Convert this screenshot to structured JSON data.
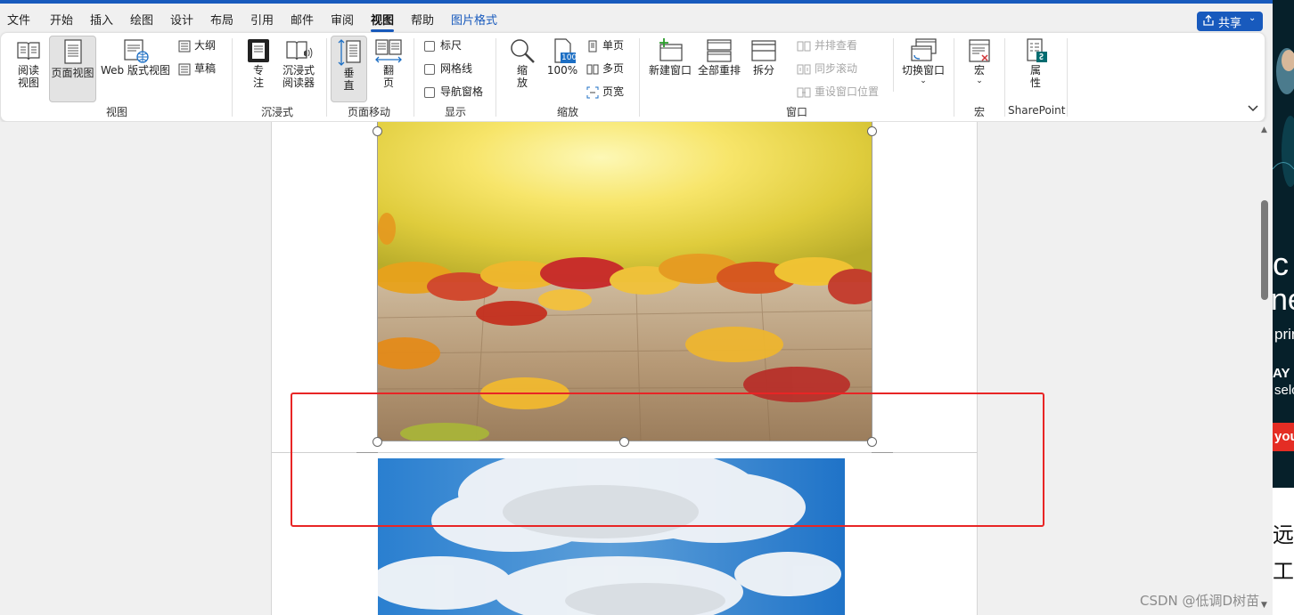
{
  "menubar": {
    "tabs": [
      {
        "label": "文件"
      },
      {
        "label": "开始"
      },
      {
        "label": "插入"
      },
      {
        "label": "绘图"
      },
      {
        "label": "设计"
      },
      {
        "label": "布局"
      },
      {
        "label": "引用"
      },
      {
        "label": "邮件"
      },
      {
        "label": "审阅"
      },
      {
        "label": "视图"
      },
      {
        "label": "帮助"
      },
      {
        "label": "图片格式"
      }
    ],
    "active_tab": "视图",
    "share_label": "共享"
  },
  "ribbon": {
    "view_group": {
      "label": "视图",
      "read_mode_1": "阅读",
      "read_mode_2": "视图",
      "print_layout": "页面视图",
      "web_layout": "Web 版式视图",
      "outline": "大纲",
      "draft": "草稿"
    },
    "immersive_group": {
      "label": "沉浸式",
      "focus_1": "专",
      "focus_2": "注",
      "reader_1": "沉浸式",
      "reader_2": "阅读器"
    },
    "page_movement_group": {
      "label": "页面移动",
      "vertical_1": "垂",
      "vertical_2": "直",
      "side_1": "翻",
      "side_2": "页"
    },
    "show_group": {
      "label": "显示",
      "ruler": "标尺",
      "gridlines": "网格线",
      "nav_pane": "导航窗格"
    },
    "zoom_group": {
      "label": "缩放",
      "zoom_1": "缩",
      "zoom_2": "放",
      "zoom_100": "100%",
      "icon_badge": "100",
      "one_page": "单页",
      "multi_page": "多页",
      "page_width": "页宽"
    },
    "window_group": {
      "label": "窗口",
      "new_window": "新建窗口",
      "arrange_all": "全部重排",
      "split": "拆分",
      "side_by_side": "并排查看",
      "sync_scroll": "同步滚动",
      "reset_position": "重设窗口位置",
      "switch_windows": "切换窗口"
    },
    "macros_group": {
      "label": "宏",
      "macros": "宏"
    },
    "sharepoint_group": {
      "label": "SharePoint",
      "props_1": "属",
      "props_2": "性"
    }
  },
  "sidepanel": {
    "texts": [
      "c",
      "ne",
      "prin",
      "AY",
      "selc",
      "you",
      "远",
      "工"
    ]
  },
  "watermark": "CSDN @低调D树苗",
  "colors": {
    "accent": "#185abd",
    "highlight_box": "#e82525"
  }
}
